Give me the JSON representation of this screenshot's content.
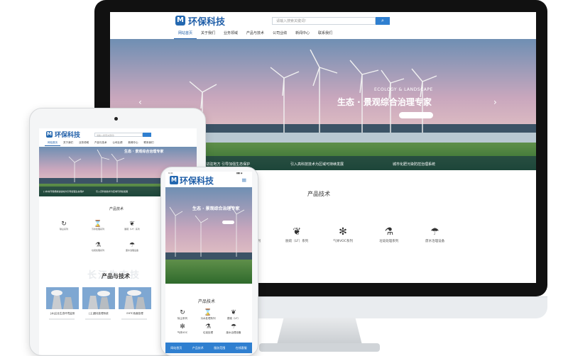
{
  "monitor": {
    "logo_letter": "M",
    "logo_text": "环保科技",
    "search_placeholder": "请输入搜索关键词!",
    "search_button": "⌕",
    "nav": [
      "网站首页",
      "关于我们",
      "业务领域",
      "产品与技术",
      "公司业绩",
      "新闻中心",
      "联系我们"
    ],
    "banner": {
      "eng_text": "ECOLOGY & LANDSCAPE",
      "title": "生态 · 景观综合治理专家",
      "prev_arrow": "‹",
      "next_arrow": "›"
    },
    "news": [
      "[ ]中央环保督察进驻地方 引导加强生态保护",
      "引入高科技技术为区域可持续发展",
      "城市化肥污染防控治理系统"
    ],
    "section_title": "产品技术",
    "products": [
      {
        "icon": "⌛",
        "label": "污水处理系列"
      },
      {
        "icon": "❦",
        "label": "脱硫（LF）系列"
      },
      {
        "icon": "✻",
        "label": "气体VOC系列"
      },
      {
        "icon": "⚗",
        "label": "垃圾处理系列"
      },
      {
        "icon": "☂",
        "label": "废水治理设备"
      }
    ]
  },
  "tablet": {
    "logo_letter": "M",
    "logo_text": "环保科技",
    "search_placeholder": "请输入搜索关键词!",
    "nav": [
      "网站首页",
      "关于我们",
      "业务领域",
      "产品与技术",
      "公司业绩",
      "新闻中心",
      "联系我们"
    ],
    "banner_title": "生态 · 景观综合治理专家",
    "news": [
      "[ ]中央环保督察进驻地方引导加强生态保护",
      "引入高科技技术为区域可持续发展"
    ],
    "section_title": "产品技术",
    "products": [
      {
        "icon": "↻",
        "label": "除尘系列"
      },
      {
        "icon": "⌛",
        "label": "污水处理系列"
      },
      {
        "icon": "❦",
        "label": "脱硫（LF）系列"
      },
      {
        "icon": "⚗",
        "label": "垃圾处理系列"
      },
      {
        "icon": "☂",
        "label": "废水治理设备"
      }
    ],
    "watermark": "长江生态技",
    "section2_title": "产品与技术",
    "cards": [
      "[水]企业生态环境监测",
      "[土]固化处理系统",
      "EHTC危废处理"
    ]
  },
  "phone": {
    "status_left": "9:41",
    "status_right": "▮▮▮ ◉",
    "logo_letter": "M",
    "logo_text": "环保科技",
    "menu_icon": "≡",
    "banner_title": "生态 · 景观综合治理专家",
    "section_title": "产品技术",
    "products": [
      {
        "icon": "↻",
        "label": "除尘系列"
      },
      {
        "icon": "⌛",
        "label": "污水处理系列"
      },
      {
        "icon": "❦",
        "label": "脱硫（LF）"
      },
      {
        "icon": "✻",
        "label": "气体VOC"
      },
      {
        "icon": "⚗",
        "label": "垃圾处理"
      },
      {
        "icon": "☂",
        "label": "废水治理设备"
      }
    ],
    "bottom_nav": [
      "网站首页",
      "产品技术",
      "服务范围",
      "在线客服"
    ]
  }
}
